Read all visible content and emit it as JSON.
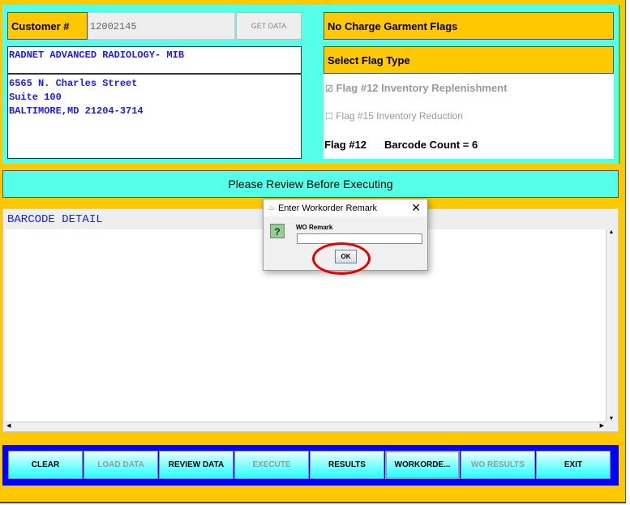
{
  "customer": {
    "label": "Customer #",
    "number": "12002145",
    "get_data": "GET DATA",
    "name": "RADNET ADVANCED RADIOLOGY- MIB",
    "address": [
      "6565 N. Charles Street",
      "Suite 100",
      "BALTIMORE,MD 21204-3714"
    ]
  },
  "flags": {
    "title": "No Charge Garment Flags",
    "select_label": "Select Flag Type",
    "options": [
      {
        "label": "Flag #12 Inventory Replenishment",
        "checked": true
      },
      {
        "label": "Flag #15 Inventory Reduction",
        "checked": false
      }
    ],
    "selected_flag": "Flag #12",
    "barcode_count": "Barcode Count = 6"
  },
  "banner": "Please Review Before Executing",
  "barcode_detail": {
    "title": "BARCODE DETAIL"
  },
  "dialog": {
    "title": "Enter Workorder Remark",
    "field_label": "WO Remark",
    "value": "",
    "ok": "OK"
  },
  "buttons": [
    {
      "label": "CLEAR",
      "enabled": true
    },
    {
      "label": "LOAD DATA",
      "enabled": false
    },
    {
      "label": "REVIEW DATA",
      "enabled": true
    },
    {
      "label": "EXECUTE",
      "enabled": false
    },
    {
      "label": "RESULTS",
      "enabled": true
    },
    {
      "label": "WORKORDE...",
      "enabled": true
    },
    {
      "label": "WO RESULTS",
      "enabled": false
    },
    {
      "label": "EXIT",
      "enabled": true
    }
  ],
  "colors": {
    "yellow": "#FFC800",
    "cyan": "#55FFE8",
    "blue": "#0000FF",
    "text_blue": "#1a1aff",
    "highlight": "#E00000"
  }
}
